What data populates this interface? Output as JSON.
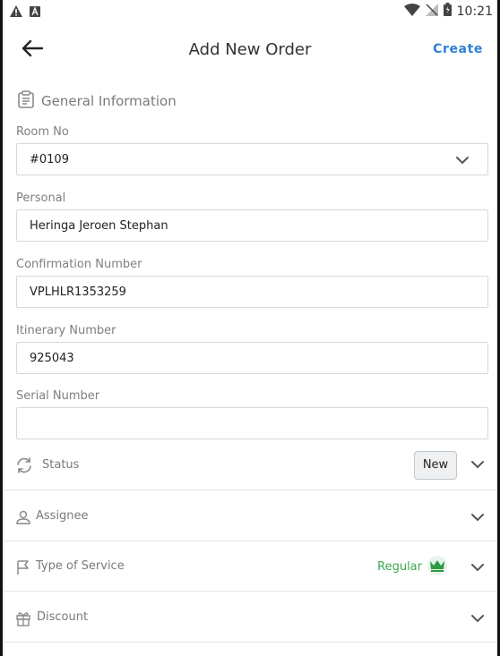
{
  "status_bar": {
    "time": "10:21",
    "icons": [
      "warning-icon",
      "android-icon",
      "wifi-icon",
      "signal-icon",
      "battery-icon"
    ]
  },
  "app_bar": {
    "title": "Add New Order",
    "action_label": "Create",
    "back_icon": "arrow-left-icon",
    "accent_color": "#2f7fd3"
  },
  "general_section": {
    "title": "General Information",
    "icon": "clipboard-icon"
  },
  "fields": {
    "room_no": {
      "label": "Room No",
      "value": "#0109"
    },
    "personal": {
      "label": "Personal",
      "value": "Heringa Jeroen Stephan"
    },
    "confirmation_number": {
      "label": "Confirmation Number",
      "value": "VPLHLR1353259"
    },
    "itinerary_number": {
      "label": "Itinerary Number",
      "value": "925043"
    },
    "serial_number": {
      "label": "Serial Number",
      "value": ""
    }
  },
  "rows": {
    "status": {
      "label": "Status",
      "value": "New",
      "icon": "sync-icon"
    },
    "assignee": {
      "label": "Assignee",
      "icon": "person-icon"
    },
    "type_of_service": {
      "label": "Type of Service",
      "value": "Regular",
      "icon": "flag-icon",
      "value_color": "#39a84d",
      "value_icon": "crown-icon"
    },
    "discount": {
      "label": "Discount",
      "icon": "gift-icon"
    }
  }
}
